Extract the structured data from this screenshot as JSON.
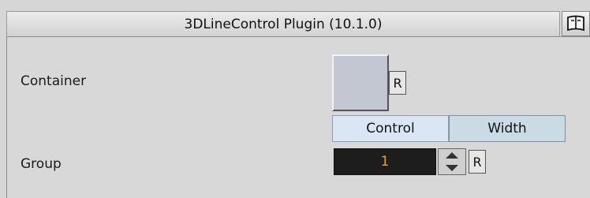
{
  "title": "3DLineControl Plugin (10.1.0)",
  "help_icon": "help-book-icon",
  "container": {
    "label": "Container",
    "reset_label": "R"
  },
  "tabs": [
    {
      "label": "Control",
      "active": true
    },
    {
      "label": "Width",
      "active": false
    }
  ],
  "group": {
    "label": "Group",
    "value": "1",
    "reset_label": "R"
  },
  "colors": {
    "background": "#d6d6d6",
    "value_text": "#f0a020",
    "value_bg": "#1d1d1d",
    "tab_active": "#dbe6f4",
    "tab_inactive": "#cbdbe6"
  }
}
